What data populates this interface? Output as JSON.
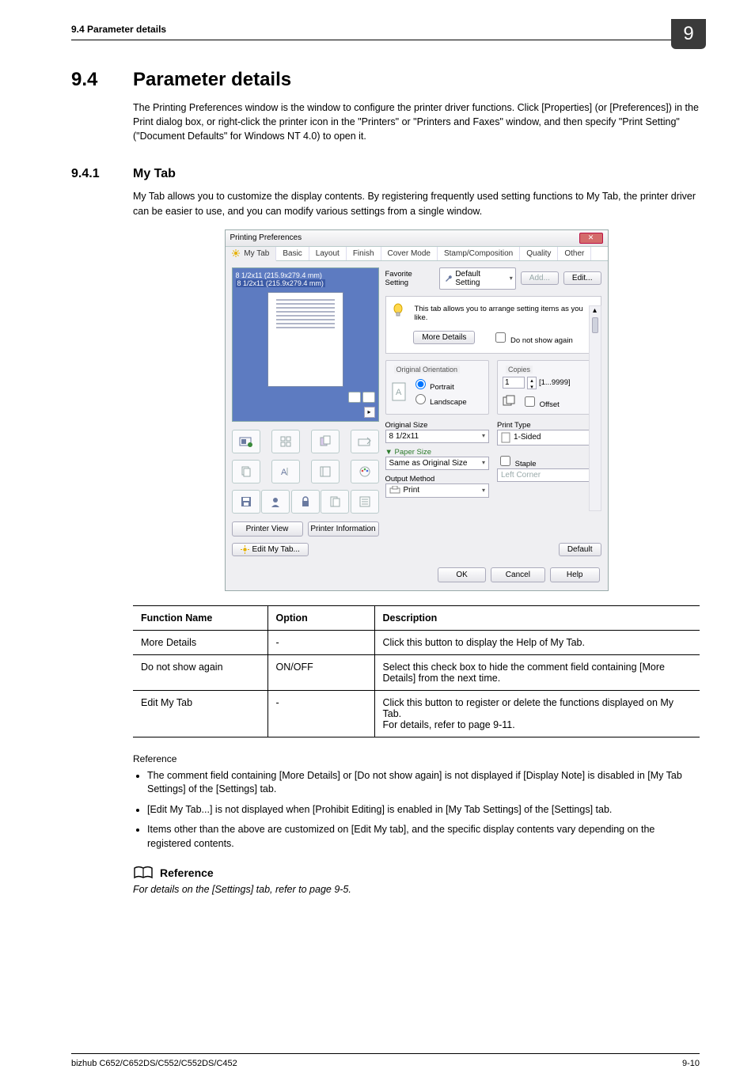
{
  "header": {
    "section_line": "9.4      Parameter details",
    "badge": "9"
  },
  "h1": {
    "num": "9.4",
    "title": "Parameter details"
  },
  "intro_para": "The Printing Preferences window is the window to configure the printer driver functions. Click [Properties] (or [Preferences]) in the Print dialog box, or right-click the printer icon in the \"Printers\" or \"Printers and Faxes\" window, and then specify \"Print Setting\" (\"Document Defaults\" for Windows NT 4.0) to open it.",
  "h2": {
    "num": "9.4.1",
    "title": "My Tab"
  },
  "mytab_para": "My Tab allows you to customize the display contents. By registering frequently used setting functions to My Tab, the printer driver can be easier to use, and you can modify various settings from a single window.",
  "dialog": {
    "title": "Printing Preferences",
    "tabs": [
      "My Tab",
      "Basic",
      "Layout",
      "Finish",
      "Cover Mode",
      "Stamp/Composition",
      "Quality",
      "Other"
    ],
    "preview_line1": "8 1/2x11 (215.9x279.4 mm)",
    "preview_line2": "8 1/2x11 (215.9x279.4 mm)",
    "left_buttons": {
      "printer_view": "Printer View",
      "printer_info": "Printer Information"
    },
    "fav_label": "Favorite Setting",
    "fav_value": "Default Setting",
    "add_btn": "Add...",
    "edit_btn": "Edit...",
    "hint_text": "This tab allows you to arrange setting items as you like.",
    "more_details": "More Details",
    "do_not_show": "Do not show again",
    "orientation": {
      "title": "Original Orientation",
      "portrait": "Portrait",
      "landscape": "Landscape"
    },
    "copies": {
      "title": "Copies",
      "value": "1",
      "range": "[1...9999]",
      "offset": "Offset"
    },
    "orig_size": {
      "label": "Original Size",
      "value": "8 1/2x11"
    },
    "paper_size": {
      "label": "Paper Size",
      "value": "Same as Original Size"
    },
    "print_type": {
      "label": "Print Type",
      "value": "1-Sided"
    },
    "output": {
      "label": "Output Method",
      "value": "Print"
    },
    "staple": {
      "label": "Staple",
      "corner": "Left Corner"
    },
    "edit_my_tab": "Edit My Tab...",
    "default_btn": "Default",
    "ok": "OK",
    "cancel": "Cancel",
    "help": "Help"
  },
  "table": {
    "headers": [
      "Function Name",
      "Option",
      "Description"
    ],
    "rows": [
      {
        "fn": "More Details",
        "opt": "-",
        "desc": "Click this button to display the Help of My Tab."
      },
      {
        "fn": "Do not show again",
        "opt": "ON/OFF",
        "desc": "Select this check box to hide the comment field containing [More Details] from the next time."
      },
      {
        "fn": "Edit My Tab",
        "opt": "-",
        "desc": "Click this button to register or delete the functions displayed on My Tab.\nFor details, refer to page 9-11."
      }
    ]
  },
  "reference_label": "Reference",
  "bullets": [
    "The comment field containing [More Details] or [Do not show again] is not displayed if [Display Note] is disabled in [My Tab Settings] of the [Settings] tab.",
    "[Edit My Tab...] is not displayed when [Prohibit Editing] is enabled in [My Tab Settings] of the [Settings] tab.",
    "Items other than the above are customized on [Edit My tab], and the specific display contents vary depending on the registered contents."
  ],
  "ref_block": {
    "label": "Reference",
    "text": "For details on the [Settings] tab, refer to page 9-5."
  },
  "footer": {
    "left": "bizhub C652/C652DS/C552/C552DS/C452",
    "right": "9-10"
  }
}
